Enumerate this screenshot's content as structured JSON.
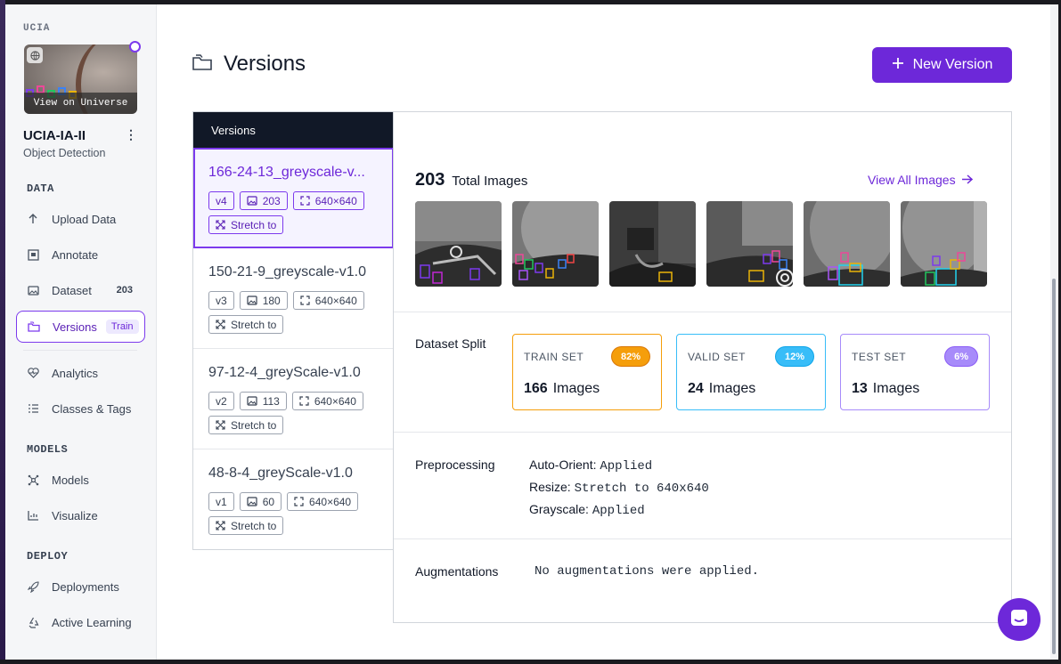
{
  "sidebar": {
    "workspace": "UCIA",
    "thumbnail_action": "View on Universe",
    "project_name": "UCIA-IA-II",
    "project_type": "Object Detection",
    "sections": {
      "data": "DATA",
      "models": "MODELS",
      "deploy": "DEPLOY"
    },
    "items": [
      {
        "label": "Upload Data",
        "icon": "upload-icon"
      },
      {
        "label": "Annotate",
        "icon": "annotate-icon"
      },
      {
        "label": "Dataset",
        "icon": "image-icon",
        "count": "203"
      },
      {
        "label": "Versions",
        "icon": "folder-icon",
        "badge": "Train",
        "active": true
      },
      {
        "label": "Analytics",
        "icon": "analytics-icon"
      },
      {
        "label": "Classes & Tags",
        "icon": "list-icon"
      },
      {
        "label": "Models",
        "icon": "model-icon"
      },
      {
        "label": "Visualize",
        "icon": "chart-icon"
      },
      {
        "label": "Deployments",
        "icon": "rocket-icon"
      },
      {
        "label": "Active Learning",
        "icon": "recycle-icon"
      }
    ]
  },
  "header": {
    "title": "Versions",
    "new_version_label": "New Version"
  },
  "versions_list": {
    "header": "Versions",
    "items": [
      {
        "name": "166-24-13_greyscale-v...",
        "version": "v4",
        "images": "203",
        "size": "640×640",
        "resize": "Stretch to"
      },
      {
        "name": "150-21-9_greyscale-v1.0",
        "version": "v3",
        "images": "180",
        "size": "640×640",
        "resize": "Stretch to"
      },
      {
        "name": "97-12-4_greyScale-v1.0",
        "version": "v2",
        "images": "113",
        "size": "640×640",
        "resize": "Stretch to"
      },
      {
        "name": "48-8-4_greyScale-v1.0",
        "version": "v1",
        "images": "60",
        "size": "640×640",
        "resize": "Stretch to"
      }
    ]
  },
  "detail": {
    "total_count": "203",
    "total_label": "Total Images",
    "view_all": "View All Images",
    "split_label": "Dataset Split",
    "splits": [
      {
        "title": "TRAIN SET",
        "pct": "82%",
        "count": "166",
        "unit": "Images",
        "color": "#f59e0b"
      },
      {
        "title": "VALID SET",
        "pct": "12%",
        "count": "24",
        "unit": "Images",
        "color": "#38bdf8"
      },
      {
        "title": "TEST SET",
        "pct": "6%",
        "count": "13",
        "unit": "Images",
        "color": "#a78bfa"
      }
    ],
    "preprocessing_label": "Preprocessing",
    "preprocessing": [
      {
        "key": "Auto-Orient:",
        "value": "Applied"
      },
      {
        "key": "Resize:",
        "value": "Stretch to 640x640"
      },
      {
        "key": "Grayscale:",
        "value": "Applied"
      }
    ],
    "augmentations_label": "Augmentations",
    "augmentations_text": "No augmentations were applied."
  },
  "colors": {
    "accent": "#6d28d9",
    "sidebar_bg": "#f5f6f8",
    "header_dark": "#111827"
  }
}
